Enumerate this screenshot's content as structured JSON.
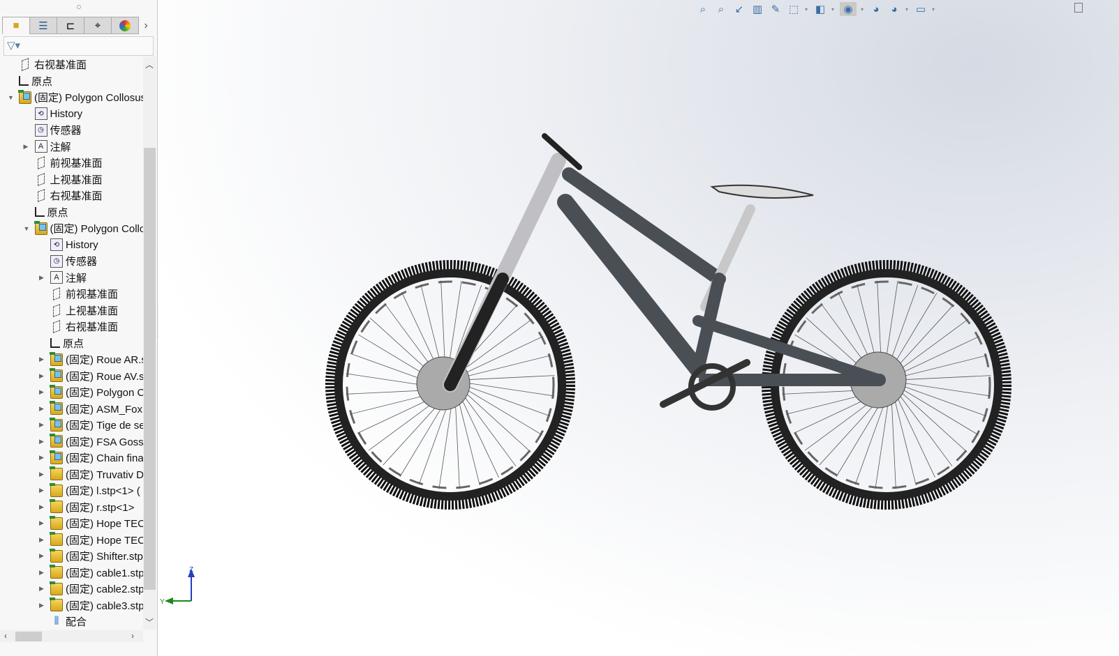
{
  "panel": {
    "tabs": [
      {
        "name": "featuremanager-tab",
        "icon": "assembly-icon"
      },
      {
        "name": "propertymanager-tab",
        "icon": "list-icon"
      },
      {
        "name": "configurationmanager-tab",
        "icon": "config-icon"
      },
      {
        "name": "dimxpert-tab",
        "icon": "crosshair-icon"
      },
      {
        "name": "displaymanager-tab",
        "icon": "color-wheel-icon"
      }
    ],
    "filter_icon": "filter-icon",
    "tree": [
      {
        "level": 0,
        "icon": "plane",
        "label": "右视基准面"
      },
      {
        "level": 0,
        "icon": "origin",
        "label": "原点"
      },
      {
        "level": 0,
        "icon": "asm-blue",
        "label": "(固定) Polygon Collosus",
        "expanded": true
      },
      {
        "level": 1,
        "icon": "hist",
        "label": "History"
      },
      {
        "level": 1,
        "icon": "sensor",
        "label": "传感器"
      },
      {
        "level": 1,
        "icon": "ann",
        "label": "注解",
        "collapsed": true
      },
      {
        "level": 1,
        "icon": "plane",
        "label": "前视基准面"
      },
      {
        "level": 1,
        "icon": "plane",
        "label": "上视基准面"
      },
      {
        "level": 1,
        "icon": "plane",
        "label": "右视基准面"
      },
      {
        "level": 1,
        "icon": "origin",
        "label": "原点"
      },
      {
        "level": 1,
        "icon": "asm-blue",
        "label": "(固定) Polygon Collosus",
        "expanded": true
      },
      {
        "level": 2,
        "icon": "hist",
        "label": "History"
      },
      {
        "level": 2,
        "icon": "sensor",
        "label": "传感器"
      },
      {
        "level": 2,
        "icon": "ann",
        "label": "注解",
        "collapsed": true
      },
      {
        "level": 2,
        "icon": "plane",
        "label": "前视基准面"
      },
      {
        "level": 2,
        "icon": "plane",
        "label": "上视基准面"
      },
      {
        "level": 2,
        "icon": "plane",
        "label": "右视基准面"
      },
      {
        "level": 2,
        "icon": "origin",
        "label": "原点"
      },
      {
        "level": 2,
        "icon": "asm-blue",
        "label": "(固定) Roue AR.stp",
        "collapsed": true
      },
      {
        "level": 2,
        "icon": "asm-blue",
        "label": "(固定) Roue AV.stp",
        "collapsed": true
      },
      {
        "level": 2,
        "icon": "asm-blue",
        "label": "(固定) Polygon Collosus",
        "collapsed": true
      },
      {
        "level": 2,
        "icon": "asm-blue",
        "label": "(固定) ASM_Fox",
        "collapsed": true
      },
      {
        "level": 2,
        "icon": "asm-blue",
        "label": "(固定) Tige de selle",
        "collapsed": true
      },
      {
        "level": 2,
        "icon": "asm-blue",
        "label": "(固定) FSA Goss.",
        "collapsed": true
      },
      {
        "level": 2,
        "icon": "asm-blue",
        "label": "(固定) Chain final",
        "collapsed": true
      },
      {
        "level": 2,
        "icon": "asm",
        "label": "(固定) Truvativ D",
        "collapsed": true
      },
      {
        "level": 2,
        "icon": "asm",
        "label": "(固定) l.stp<1> (",
        "collapsed": true
      },
      {
        "level": 2,
        "icon": "asm",
        "label": "(固定) r.stp<1>",
        "collapsed": true
      },
      {
        "level": 2,
        "icon": "asm",
        "label": "(固定) Hope TECH",
        "collapsed": true
      },
      {
        "level": 2,
        "icon": "asm",
        "label": "(固定) Hope TECH",
        "collapsed": true
      },
      {
        "level": 2,
        "icon": "asm",
        "label": "(固定) Shifter.stp",
        "collapsed": true
      },
      {
        "level": 2,
        "icon": "asm",
        "label": "(固定) cable1.stp",
        "collapsed": true
      },
      {
        "level": 2,
        "icon": "asm",
        "label": "(固定) cable2.stp",
        "collapsed": true
      },
      {
        "level": 2,
        "icon": "asm",
        "label": "(固定) cable3.stp",
        "collapsed": true
      },
      {
        "level": 2,
        "icon": "mate",
        "label": "配合"
      }
    ]
  },
  "toolbar": [
    "zoom-to-fit-icon",
    "zoom-to-area-icon",
    "previous-view-icon",
    "section-view-icon",
    "dynamic-annotation-icon",
    "view-orientation-icon",
    "display-style-icon",
    "hide-show-items-icon",
    "edit-appearance-icon",
    "apply-scene-icon",
    "view-settings-icon"
  ],
  "triad": {
    "z": "Z",
    "y": "Y"
  },
  "colors": {
    "frame": "#4a4f55",
    "tire": "#111111",
    "fork": "#b9b9bd",
    "accent": "#3a6ea5"
  }
}
